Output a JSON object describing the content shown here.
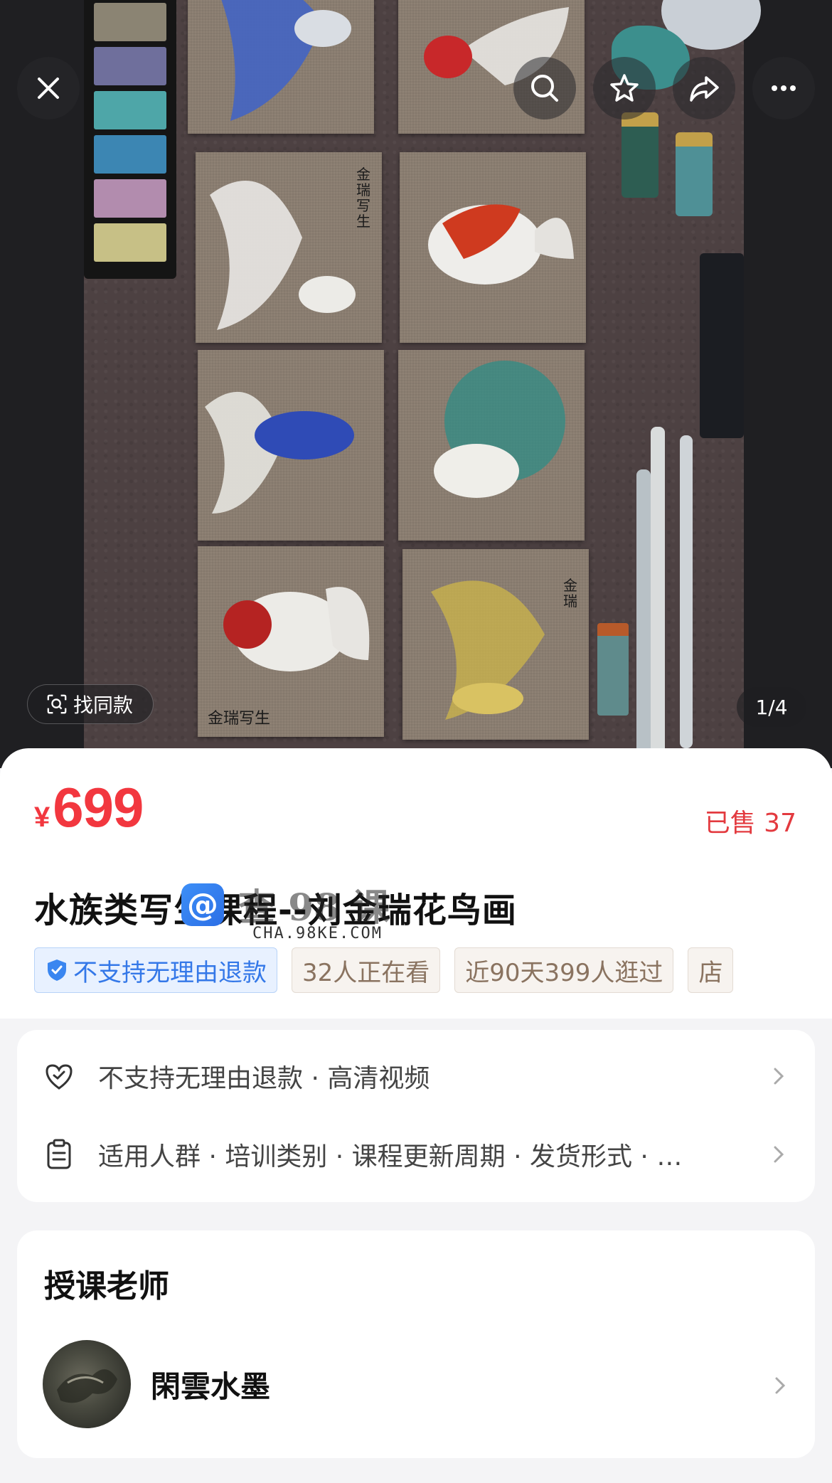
{
  "top_bar": {
    "close_icon": "close-icon",
    "search_icon": "search-icon",
    "favorite_icon": "star-icon",
    "share_icon": "share-icon",
    "more_icon": "more-icon"
  },
  "image": {
    "find_same_label": "找同款",
    "pager": "1/4",
    "card_inscriptions": [
      "金瑞写生",
      "金瑞",
      "金瑞写生"
    ]
  },
  "product": {
    "currency": "¥",
    "price": "699",
    "sold": "已售 37",
    "title": "水族类写生课程--刘金瑞花鸟画",
    "watermark": {
      "big": "查 98 课",
      "small": "CHA.98KE.COM",
      "logo_glyph": "@"
    },
    "tags": [
      {
        "label": "不支持无理由退款",
        "style": "blue",
        "icon": "shield-check-icon"
      },
      {
        "label": "32人正在看",
        "style": "gray"
      },
      {
        "label": "近90天399人逛过",
        "style": "gray"
      },
      {
        "label": "店",
        "style": "gray"
      }
    ]
  },
  "info_rows": [
    {
      "icon": "heart-shield-icon",
      "text": "不支持无理由退款 · 高清视频"
    },
    {
      "icon": "clipboard-icon",
      "text": "适用人群 · 培训类别 · 课程更新周期 · 发货形式 · …"
    }
  ],
  "teacher": {
    "section_title": "授课老师",
    "name": "閑雲水墨"
  },
  "colors": {
    "price_red": "#f2373f",
    "tag_blue": "#3478e8",
    "tag_gray_text": "#8a7360"
  }
}
